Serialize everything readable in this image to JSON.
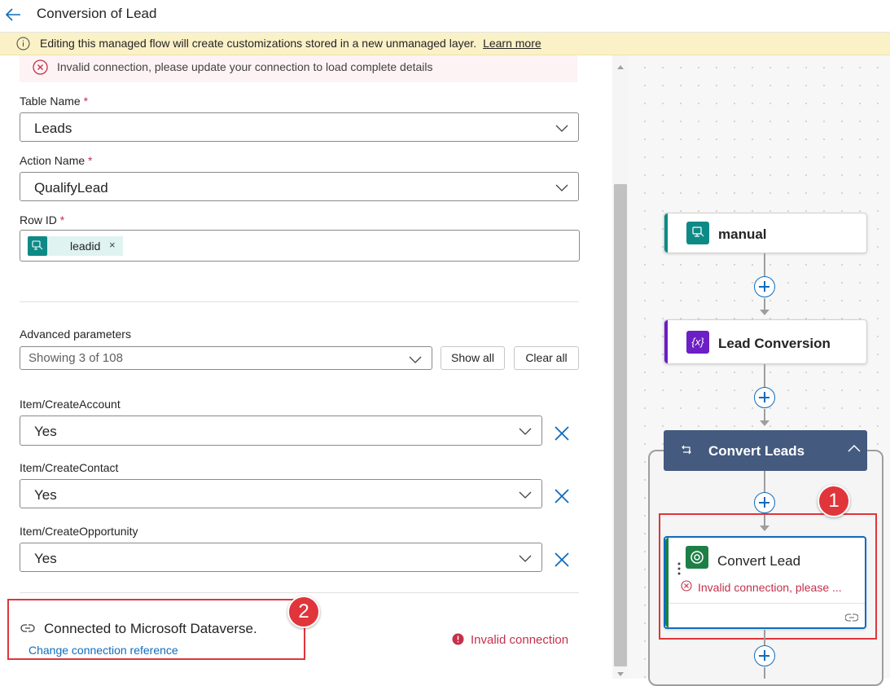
{
  "header": {
    "title": "Conversion of Lead"
  },
  "warning": {
    "text": "Editing this managed flow will create customizations stored in a new unmanaged layer.",
    "link": "Learn more"
  },
  "error_banner": {
    "text": "Invalid connection, please update your connection to load complete details"
  },
  "form": {
    "table_name": {
      "label": "Table Name",
      "required": "*",
      "value": "Leads"
    },
    "action_name": {
      "label": "Action Name",
      "required": "*",
      "value": "QualifyLead"
    },
    "row_id": {
      "label": "Row ID",
      "required": "*",
      "token": "leadid",
      "token_remove": "×"
    },
    "advanced": {
      "label": "Advanced parameters",
      "value": "Showing 3 of 108",
      "show_all": "Show all",
      "clear_all": "Clear all"
    },
    "params": [
      {
        "label": "Item/CreateAccount",
        "value": "Yes"
      },
      {
        "label": "Item/CreateContact",
        "value": "Yes"
      },
      {
        "label": "Item/CreateOpportunity",
        "value": "Yes"
      }
    ],
    "connection": {
      "text": "Connected to Microsoft Dataverse.",
      "link": "Change connection reference",
      "status": "Invalid connection"
    }
  },
  "badges": {
    "one": "1",
    "two": "2"
  },
  "canvas": {
    "nodes": [
      {
        "title": "manual",
        "color": "#0e8a86",
        "icon": "trigger-icon"
      },
      {
        "title": "Lead Conversion",
        "color": "#6b1fc4",
        "icon": "variable-icon",
        "icon_text": "{x}"
      },
      {
        "title": "Convert Leads",
        "color": "#445a7e",
        "icon": "loop-icon"
      },
      {
        "title": "Convert Lead",
        "color": "#1d7f46",
        "icon": "dataverse-icon",
        "error": "Invalid connection, please ..."
      }
    ]
  },
  "colors": {
    "accent": "#0f6cbd",
    "error": "#c4314b",
    "warning_bg": "#fbf1c7",
    "highlight": "#e0353b"
  }
}
